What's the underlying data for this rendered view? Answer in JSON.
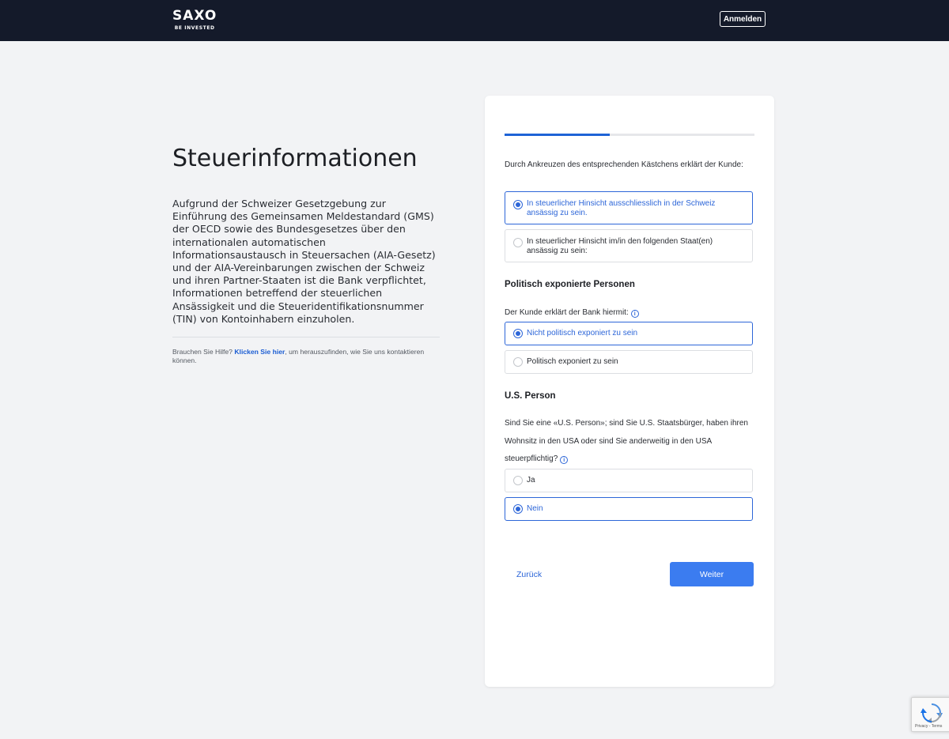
{
  "header": {
    "logo_main": "SAXO",
    "logo_sub": "BE INVESTED",
    "login_label": "Anmelden"
  },
  "left": {
    "title": "Steuerinformationen",
    "intro": "Aufgrund der Schweizer Gesetzgebung zur Einführung des Gemeinsamen Meldestandard (GMS) der OECD sowie des Bundesgesetzes über den internationalen automatischen Informationsaustausch in Steuersachen (AIA-Gesetz) und der AIA-Vereinbarungen zwischen der Schweiz und ihren Partner-Staaten ist die Bank verpflichtet, Informationen betreffend der steuerlichen Ansässigkeit und die Steueridentifikationsnummer (TIN) von Kontoinhabern einzuholen.",
    "help_prefix": "Brauchen Sie Hilfe? ",
    "help_link": "Klicken Sie hier",
    "help_suffix": ", um herauszufinden, wie Sie uns kontaktieren können."
  },
  "form": {
    "progress": 0.42,
    "residence_statement": "Durch Ankreuzen des entsprechenden Kästchens erklärt der Kunde:",
    "residence_options": [
      {
        "label": "In steuerlicher Hinsicht ausschliesslich in der Schweiz ansässig zu sein.",
        "selected": true
      },
      {
        "label": "In steuerlicher Hinsicht im/in den folgenden Staat(en) ansässig zu sein:",
        "selected": false
      }
    ],
    "pep_heading": "Politisch exponierte Personen",
    "pep_question": "Der Kunde erklärt der Bank hiermit:",
    "pep_options": [
      {
        "label": "Nicht politisch exponiert zu sein",
        "selected": true
      },
      {
        "label": "Politisch exponiert zu sein",
        "selected": false
      }
    ],
    "us_heading": "U.S. Person",
    "us_question": "Sind Sie eine «U.S. Person»; sind Sie U.S. Staatsbürger, haben ihren Wohnsitz in den USA oder sind Sie anderweitig in den USA steuerpflichtig?",
    "us_options": [
      {
        "label": "Ja",
        "selected": false
      },
      {
        "label": "Nein",
        "selected": true
      }
    ],
    "info_icon_glyph": "i",
    "back_label": "Zurück",
    "next_label": "Weiter"
  },
  "recaptcha": {
    "text": "Privacy - Terms"
  },
  "colors": {
    "header_bg": "#141a2a",
    "accent": "#2d66d8",
    "button_bg": "#3b7cf0",
    "page_bg": "#f2f3f5"
  }
}
